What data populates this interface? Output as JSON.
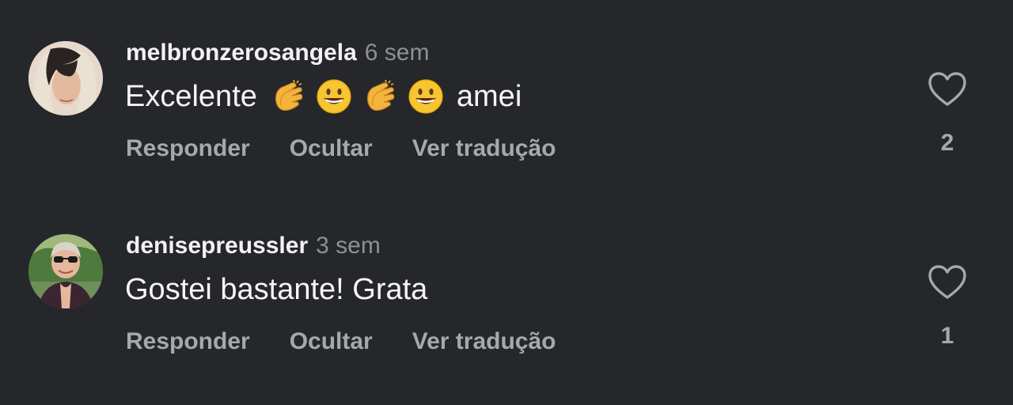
{
  "colors": {
    "background": "#25272b",
    "primary_text": "#f5f5f5",
    "secondary_text": "#8e9096",
    "action_text": "#a6a8ae"
  },
  "comments": [
    {
      "username": "melbronzerosangela",
      "time": "6 sem",
      "text_before": "Excelente",
      "emojis": [
        "clapping-hands-emoji",
        "grinning-face-emoji",
        "clapping-hands-emoji",
        "grinning-face-emoji"
      ],
      "text_after": "amei",
      "actions": {
        "reply": "Responder",
        "hide": "Ocultar",
        "translate": "Ver tradução"
      },
      "like_icon": "heart-outline-icon",
      "likes": "2"
    },
    {
      "username": "denisepreussler",
      "time": "3 sem",
      "text_before": "Gostei bastante! Grata",
      "actions": {
        "reply": "Responder",
        "hide": "Ocultar",
        "translate": "Ver tradução"
      },
      "like_icon": "heart-outline-icon",
      "likes": "1"
    }
  ]
}
